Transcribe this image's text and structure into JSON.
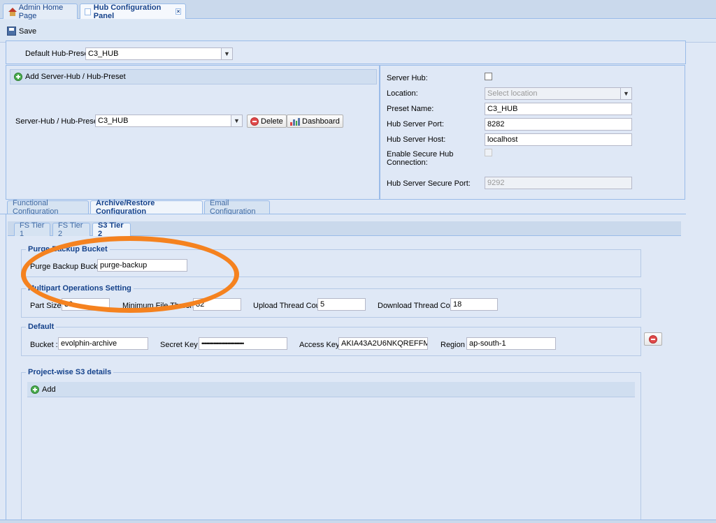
{
  "tabs": {
    "home": "Admin Home Page",
    "hub": "Hub Configuration Panel",
    "close": "×"
  },
  "toolbar": {
    "save": "Save"
  },
  "default_preset": {
    "label": "Default Hub-Preset :",
    "value": "C3_HUB"
  },
  "server_hub_panel": {
    "add_label": "Add Server-Hub / Hub-Preset",
    "preset_label": "Server-Hub / Hub-Preset :",
    "preset_value": "C3_HUB",
    "delete": "Delete",
    "dashboard": "Dashboard"
  },
  "hub_details": {
    "server_hub_label": "Server Hub:",
    "location_label": "Location:",
    "location_placeholder": "Select location",
    "preset_name_label": "Preset Name:",
    "preset_name": "C3_HUB",
    "port_label": "Hub Server Port:",
    "port": "8282",
    "host_label": "Hub Server Host:",
    "host": "localhost",
    "secure_label_1": "Enable Secure Hub",
    "secure_label_2": "Connection:",
    "secure_port_label": "Hub Server Secure Port:",
    "secure_port": "9292"
  },
  "config_tabs": [
    "Functional Configuration",
    "Archive/Restore Configuration",
    "Email Configuration"
  ],
  "tier_tabs": [
    "FS Tier 1",
    "FS Tier 2",
    "S3 Tier 2"
  ],
  "purge": {
    "legend": "Purge Backup Bucket",
    "label": "Purge Backup Bucket",
    "value": "purge-backup"
  },
  "multipart": {
    "legend": "Multipart Operations Setting",
    "part_size_label": "Part Size",
    "part_size": "30",
    "threshold_label": "Minimum File Threshold",
    "threshold": "32",
    "upload_label": "Upload Thread Count",
    "upload": "5",
    "download_label": "Download Thread Count",
    "download": "18"
  },
  "default_s3": {
    "legend": "Default",
    "bucket_label": "Bucket :",
    "bucket": "evolphin-archive",
    "secret_label": "Secret Key :",
    "secret": "••••••••••••••••••••••••••••",
    "access_label": "Access Key :",
    "access": "AKIA43A2U6NKQREFFME4",
    "region_label": "Region :",
    "region": "ap-south-1"
  },
  "project_s3": {
    "legend": "Project-wise S3 details",
    "add": "Add"
  },
  "colors": {
    "background": "#dfe8f6",
    "border": "#99bbe8",
    "title_text": "#15428b",
    "highlight_ellipse": "#f5821f"
  }
}
